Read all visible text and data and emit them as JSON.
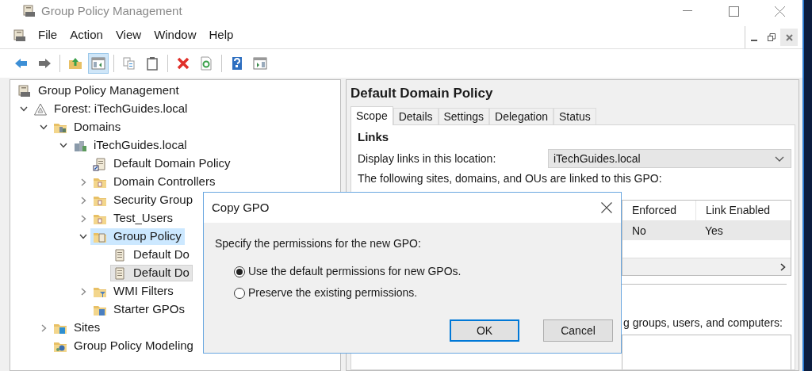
{
  "window": {
    "title": "Group Policy Management"
  },
  "menu": [
    "File",
    "Action",
    "View",
    "Window",
    "Help"
  ],
  "toolbar": [
    {
      "kind": "back",
      "pressed": false
    },
    {
      "kind": "forward",
      "pressed": false
    },
    {
      "kind": "sep"
    },
    {
      "kind": "up",
      "pressed": false
    },
    {
      "kind": "tree",
      "pressed": true
    },
    {
      "kind": "sep"
    },
    {
      "kind": "copy",
      "pressed": false
    },
    {
      "kind": "paste",
      "pressed": false
    },
    {
      "kind": "sep"
    },
    {
      "kind": "delete",
      "pressed": false
    },
    {
      "kind": "refresh",
      "pressed": false
    },
    {
      "kind": "sep"
    },
    {
      "kind": "help",
      "pressed": false
    },
    {
      "kind": "pane",
      "pressed": false
    }
  ],
  "tree": [
    {
      "label": "Group Policy Management",
      "kind": "console",
      "selected": false,
      "children": [
        {
          "label": "Forest: iTechGuides.local",
          "kind": "forest",
          "expanded": true,
          "selected": false,
          "children": [
            {
              "label": "Domains",
              "kind": "domains",
              "expanded": true,
              "selected": false,
              "children": [
                {
                  "label": "iTechGuides.local",
                  "kind": "domain",
                  "expanded": true,
                  "selected": false,
                  "children": [
                    {
                      "label": "Default Domain Policy",
                      "kind": "gpo-link",
                      "selected": false
                    },
                    {
                      "label": "Domain Controllers",
                      "kind": "ou",
                      "expanded": false,
                      "selected": false
                    },
                    {
                      "label": "Security Group",
                      "kind": "ou",
                      "expanded": false,
                      "selected": false
                    },
                    {
                      "label": "Test_Users",
                      "kind": "ou",
                      "expanded": false,
                      "selected": false
                    },
                    {
                      "label": "Group Policy",
                      "kind": "gpo-folder",
                      "expanded": true,
                      "selected": true,
                      "children": [
                        {
                          "label": "Default Do",
                          "kind": "gpo",
                          "selected": false
                        },
                        {
                          "label": "Default Do",
                          "kind": "gpo",
                          "selected": false,
                          "focused": true
                        }
                      ]
                    },
                    {
                      "label": "WMI Filters",
                      "kind": "wmi",
                      "expanded": false,
                      "selected": false
                    },
                    {
                      "label": "Starter GPOs",
                      "kind": "starter",
                      "selected": false
                    }
                  ]
                }
              ]
            },
            {
              "label": "Sites",
              "kind": "sites",
              "expanded": false,
              "selected": false
            },
            {
              "label": "Group Policy Modeling",
              "kind": "modeling",
              "selected": false
            }
          ]
        }
      ]
    }
  ],
  "details": {
    "title": "Default Domain Policy",
    "tabs": [
      {
        "label": "Scope",
        "selected": true
      },
      {
        "label": "Details",
        "selected": false
      },
      {
        "label": "Settings",
        "selected": false
      },
      {
        "label": "Delegation",
        "selected": false
      },
      {
        "label": "Status",
        "selected": false
      }
    ],
    "links_heading": "Links",
    "location_label": "Display links in this location:",
    "location_value": "iTechGuides.local",
    "linked_text": "The following sites, domains, and OUs are linked to this GPO:",
    "columns": [
      "Enforced",
      "Link Enabled"
    ],
    "rows": [
      {
        "cells": [
          "No",
          "Yes"
        ],
        "selected": true
      }
    ],
    "filtering_text": "g groups, users, and computers:"
  },
  "dialog": {
    "title": "Copy GPO",
    "prompt": "Specify the permissions for the new GPO:",
    "options": [
      {
        "label": "Use the default permissions for new GPOs.",
        "selected": true
      },
      {
        "label": "Preserve the existing permissions.",
        "selected": false
      }
    ],
    "buttons": [
      {
        "label": "OK",
        "default": true
      },
      {
        "label": "Cancel",
        "default": false
      }
    ]
  }
}
